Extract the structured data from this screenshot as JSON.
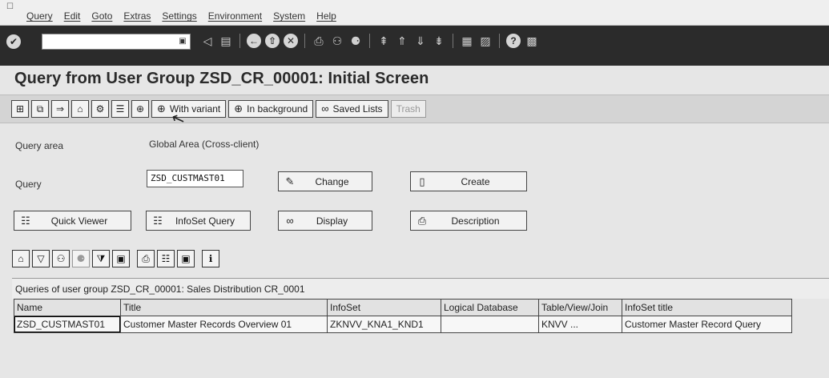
{
  "colors": {
    "background": "#e6e6e6",
    "toolbar_dark": "#2b2b2b",
    "app_toolbar": "#d4d4d4",
    "button_face": "#f2f2f2"
  },
  "menubar": {
    "icon": "menu-toggle-icon",
    "items": [
      "Query",
      "Edit",
      "Goto",
      "Extras",
      "Settings",
      "Environment",
      "System",
      "Help"
    ]
  },
  "standard_toolbar": {
    "command_field_value": "",
    "icons": [
      "enter-icon",
      "back-icon",
      "save-icon",
      "back-arrow-icon",
      "exit-icon",
      "cancel-icon",
      "print-icon",
      "find-icon",
      "find-next-icon",
      "first-page-icon",
      "previous-page-icon",
      "next-page-icon",
      "last-page-icon",
      "new-session-icon",
      "shortcut-icon",
      "help-icon",
      "layout-icon"
    ]
  },
  "page": {
    "title": "Query from User Group ZSD_CR_00001: Initial Screen"
  },
  "app_toolbar": {
    "with_variant": "With variant",
    "in_background": "In background",
    "saved_lists": "Saved Lists",
    "trash": "Trash"
  },
  "form": {
    "query_area_label": "Query area",
    "query_area_value": "Global Area (Cross-client)",
    "query_label": "Query",
    "query_value": "ZSD_CUSTMAST01",
    "change": "Change",
    "create": "Create",
    "quick_viewer": "Quick Viewer",
    "infoset_query": "InfoSet Query",
    "display": "Display",
    "description": "Description"
  },
  "list": {
    "header": "Queries of user group ZSD_CR_00001: Sales Distribution CR_0001",
    "columns": [
      "Name",
      "Title",
      "InfoSet",
      "Logical Database",
      "Table/View/Join",
      "InfoSet title"
    ],
    "rows": [
      [
        "ZSD_CUSTMAST01",
        "Customer Master Records Overview 01",
        "ZKNVV_KNA1_KND1",
        "",
        "KNVV ...",
        "Customer Master Record Query"
      ]
    ]
  }
}
